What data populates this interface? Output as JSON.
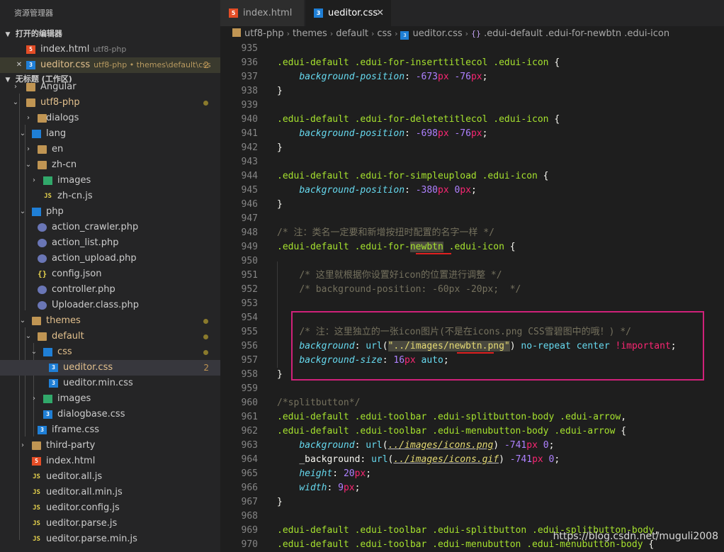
{
  "sidebar": {
    "title": "资源管理器",
    "open_editors_header": "打开的编辑器",
    "open_editors": [
      {
        "name": "index.html",
        "path": "utf8-php"
      },
      {
        "name": "ueditor.css",
        "path": "utf8-php • themes\\default\\css",
        "count": "2",
        "close": "✕"
      }
    ],
    "workspace_header": "无标题 (工作区)",
    "tree": [
      {
        "label": "Angular"
      },
      {
        "label": "utf8-php"
      },
      {
        "label": "dialogs"
      },
      {
        "label": "lang"
      },
      {
        "label": "en"
      },
      {
        "label": "zh-cn"
      },
      {
        "label": "images"
      },
      {
        "label": "zh-cn.js"
      },
      {
        "label": "php"
      },
      {
        "label": "action_crawler.php"
      },
      {
        "label": "action_list.php"
      },
      {
        "label": "action_upload.php"
      },
      {
        "label": "config.json"
      },
      {
        "label": "controller.php"
      },
      {
        "label": "Uploader.class.php"
      },
      {
        "label": "themes"
      },
      {
        "label": "default"
      },
      {
        "label": "css"
      },
      {
        "label": "ueditor.css",
        "count": "2"
      },
      {
        "label": "ueditor.min.css"
      },
      {
        "label": "images"
      },
      {
        "label": "dialogbase.css"
      },
      {
        "label": "iframe.css"
      },
      {
        "label": "third-party"
      },
      {
        "label": "index.html"
      },
      {
        "label": "ueditor.all.js"
      },
      {
        "label": "ueditor.all.min.js"
      },
      {
        "label": "ueditor.config.js"
      },
      {
        "label": "ueditor.parse.js"
      },
      {
        "label": "ueditor.parse.min.js"
      }
    ]
  },
  "tabs": [
    {
      "label": "index.html"
    },
    {
      "label": "ueditor.css",
      "close": "✕"
    }
  ],
  "breadcrumb": [
    "utf8-php",
    "themes",
    "default",
    "css",
    "ueditor.css",
    ".edui-default .edui-for-newbtn .edui-icon"
  ],
  "editor": {
    "lines": [
      {
        "n": "935"
      },
      {
        "n": "936"
      },
      {
        "n": "937"
      },
      {
        "n": "938"
      },
      {
        "n": "939"
      },
      {
        "n": "940"
      },
      {
        "n": "941"
      },
      {
        "n": "942"
      },
      {
        "n": "943"
      },
      {
        "n": "944"
      },
      {
        "n": "945"
      },
      {
        "n": "946"
      },
      {
        "n": "947"
      },
      {
        "n": "948"
      },
      {
        "n": "949"
      },
      {
        "n": "950"
      },
      {
        "n": "951"
      },
      {
        "n": "952"
      },
      {
        "n": "953"
      },
      {
        "n": "954"
      },
      {
        "n": "955"
      },
      {
        "n": "956"
      },
      {
        "n": "957"
      },
      {
        "n": "958"
      },
      {
        "n": "959"
      },
      {
        "n": "960"
      },
      {
        "n": "961"
      },
      {
        "n": "962"
      },
      {
        "n": "963"
      },
      {
        "n": "964"
      },
      {
        "n": "965"
      },
      {
        "n": "966"
      },
      {
        "n": "967"
      },
      {
        "n": "968"
      },
      {
        "n": "969"
      },
      {
        "n": "970"
      }
    ],
    "t": {
      "s936": ".edui-default .edui-for-inserttitlecol .edui-icon",
      "s940": ".edui-default .edui-for-deletetitlecol .edui-icon",
      "s944": ".edui-default .edui-for-simpleupload .edui-icon",
      "bp": "background-position",
      "v936a": "-673",
      "v936b": "-76",
      "v940a": "-698",
      "v940b": "-76",
      "v944a": "-380",
      "v944b": "0",
      "px": "px",
      "c948": "/* 注：类名一定要和新增按扭时配置的名字一样 */",
      "s949a": ".edui-default .edui-for-",
      "s949b": "newbtn",
      "s949c": " .edui-icon",
      "c951": "/* 这里就根据你设置好icon的位置进行调整 */",
      "c952": "/* background-position: -60px -20px;  */",
      "c955": "/* 注：这里独立的一张icon图片(不是在icons.png CSS雪碧图中的哦！) */",
      "bg": "background",
      "url": "url",
      "str956a": "\"../images/",
      "str956b": "newbtn",
      "str956c": ".png\"",
      "no_repeat": "no-repeat",
      "center": "center",
      "important": "!important",
      "bgsize": "background-size",
      "v957": "16",
      "auto": "auto",
      "c960": "/*splitbutton*/",
      "s961": ".edui-default .edui-toolbar .edui-splitbutton-body .edui-arrow",
      "s962": ".edui-default .edui-toolbar .edui-menubutton-body .edui-arrow",
      "u963": "../images/icons.png",
      "u964": "../images/icons.gif",
      "bg964": "_background",
      "v963": "-741",
      "v963b": "0",
      "height": "height",
      "v965": "20",
      "width": "width",
      "v966": "9",
      "s969": ".edui-default .edui-toolbar .edui-splitbutton .edui-splitbutton-body",
      "s970": ".edui-default .edui-toolbar .edui-menubutton .edui-menubutton-body"
    }
  },
  "watermark": "https://blog.csdn.net/muguli2008",
  "colors": {
    "accent_box": "#d0217a",
    "underline": "#e02020"
  }
}
